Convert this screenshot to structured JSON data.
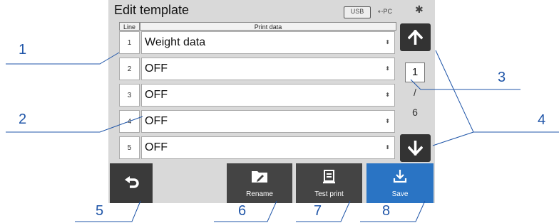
{
  "title": "Edit template",
  "status": {
    "usb": "USB",
    "pc": "PC",
    "bt": "✱"
  },
  "table": {
    "header_line": "Line",
    "header_print": "Print data",
    "rows": [
      {
        "line": "1",
        "value": "Weight data"
      },
      {
        "line": "2",
        "value": "OFF"
      },
      {
        "line": "3",
        "value": "OFF"
      },
      {
        "line": "4",
        "value": "OFF"
      },
      {
        "line": "5",
        "value": "OFF"
      }
    ],
    "select_glyph": "⬍"
  },
  "pager": {
    "current": "1",
    "separator": "/",
    "total": "6"
  },
  "buttons": {
    "rename": "Rename",
    "test_print": "Test print",
    "save": "Save"
  },
  "callouts": [
    "1",
    "2",
    "3",
    "4",
    "5",
    "6",
    "7",
    "8"
  ],
  "colors": {
    "accent": "#2a74c4",
    "callout": "#1f55a8",
    "dark": "#333333"
  }
}
